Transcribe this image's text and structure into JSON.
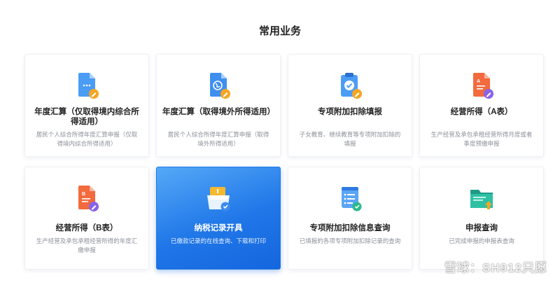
{
  "section_title": "常用业务",
  "cards": [
    {
      "title": "年度汇算（仅取得境内综合所得适用）",
      "desc": "居民个人综合所得年度汇算申报（仅取得境内综合所得适用）",
      "icon": "document-edit-icon"
    },
    {
      "title": "年度汇算（取得境外所得适用）",
      "desc": "居民个人综合所得年度汇算申报（取得境外所得适用）",
      "icon": "globe-document-icon"
    },
    {
      "title": "专项附加扣除填报",
      "desc": "子女教育、继续教育等专项附加扣除的填报",
      "icon": "clipboard-check-icon"
    },
    {
      "title": "经营所得（A表）",
      "desc": "生产经营及承包承租经营所得月度或者季度预缴申报",
      "icon": "form-a-icon"
    },
    {
      "title": "经营所得（B表）",
      "desc": "生产经营及承包承租经营所得的年度汇缴申报",
      "icon": "form-b-icon"
    },
    {
      "title": "纳税记录开具",
      "desc": "已缴款记录的在线查询、下载和打印",
      "icon": "tax-record-box-icon"
    },
    {
      "title": "专项附加扣除信息查询",
      "desc": "已填报的各项专项附加扣除记录的查询",
      "icon": "list-scroll-icon"
    },
    {
      "title": "申报查询",
      "desc": "已完成申报的申报表查询",
      "icon": "folder-upload-icon"
    }
  ],
  "watermark": "雪球：SH912只愿",
  "colors": {
    "accent": "#2077e8",
    "orange": "#f5a623",
    "purple": "#8a63e8",
    "green": "#2bb98a"
  }
}
